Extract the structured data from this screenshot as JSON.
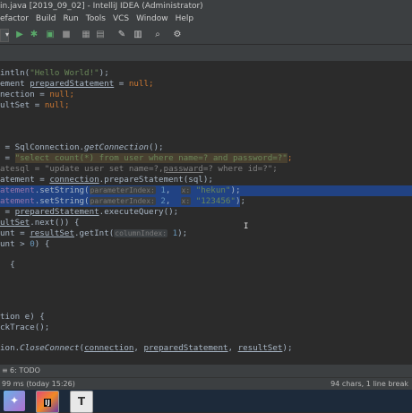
{
  "window": {
    "title": "in.java [2019_09_02] - IntelliJ IDEA (Administrator)"
  },
  "menu": [
    "efactor",
    "Build",
    "Run",
    "Tools",
    "VCS",
    "Window",
    "Help"
  ],
  "toolbar_icons": [
    "dropdown-icon",
    "run-icon",
    "debug-icon",
    "coverage-icon",
    "stop-icon",
    "build-icon",
    "attach-icon",
    "wrench-icon",
    "project-structure-icon",
    "find-icon",
    "vcs-icon"
  ],
  "code": {
    "l1": {
      "a": "intln(",
      "b": "\"Hello World!\"",
      "c": ");"
    },
    "l2": {
      "a": "ement ",
      "b": "preparedStatement",
      "c": " = ",
      "d": "null",
      "e": ";"
    },
    "l3": {
      "a": "nection",
      "b": " = ",
      "c": "null",
      "d": ";"
    },
    "l4": {
      "a": "ultSet",
      "b": " = ",
      "c": "null",
      "d": ";"
    },
    "l5": {
      "a": " = SqlConnection.",
      "b": "getConnection",
      "c": "();"
    },
    "l6": {
      "a": " = ",
      "b": "\"select count(*) from user where name=? and password=?\"",
      "c": ";"
    },
    "l7": {
      "a": "atesql = \"update user set name=?,",
      "b": "passward",
      "c": "=? where id=?\";"
    },
    "l8": {
      "a": "atement = ",
      "b": "connection",
      "c": ".prepareStatement(sql);"
    },
    "l9": {
      "a": "atement",
      "b": ".setString(",
      "hint": "parameterIndex:",
      "n": " 1",
      "c": ",  ",
      "hint2": "x:",
      "s": " \"hekun\"",
      "d": ");"
    },
    "l10": {
      "a": "atement",
      "b": ".setString(",
      "hint": "parameterIndex:",
      "n": " 2",
      "c": ",  ",
      "hint2": "x:",
      "s": " \"123456\"",
      "d": ");"
    },
    "l11": {
      "a": " = ",
      "b": "preparedStatement",
      "c": ".executeQuery();"
    },
    "l12": {
      "a": "ultSet",
      "b": ".next()) {"
    },
    "l13": {
      "a": "unt = ",
      "b": "resultSet",
      "c": ".getInt(",
      "hint": "columnIndex:",
      "n": " 1",
      "d": ");"
    },
    "l14": {
      "a": "unt > ",
      "n": "0",
      "b": ") {"
    },
    "l15": {
      "a": "  {"
    },
    "l16": {
      "a": "tion e) {"
    },
    "l17": {
      "a": "ckTrace();"
    },
    "l18": {
      "a": "ion.",
      "b": "CloseConnect",
      "c": "(",
      "d": "connection",
      "e": ", ",
      "f": "preparedStatement",
      "g": ", ",
      "h": "resultSet",
      "i": ");"
    }
  },
  "bottom": {
    "todo_label": "6: TODO"
  },
  "status": {
    "left": "99 ms (today 15:26)",
    "right": "94 chars, 1 line break"
  },
  "taskbar": {
    "items": [
      "app-icon",
      "intellij-icon",
      "text-editor-icon"
    ],
    "intellij_label": "IJ",
    "text_label": "T"
  },
  "colors": {
    "editor_bg": "#2b2b2b",
    "selection": "#214283",
    "string": "#6a8759",
    "keyword": "#cc7832",
    "field": "#9876aa"
  }
}
